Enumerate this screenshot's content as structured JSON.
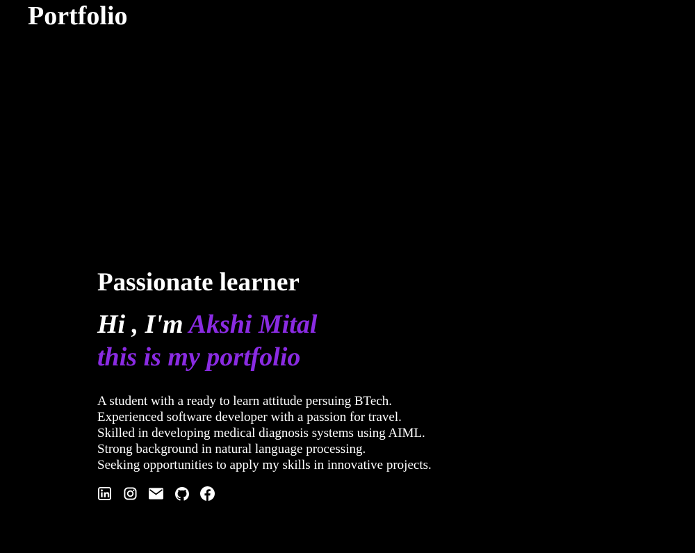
{
  "header": {
    "brand": "Portfolio"
  },
  "hero": {
    "tagline": "Passionate learner",
    "greeting_prefix": "Hi , I'm ",
    "name": "Akshi Mital",
    "greeting_suffix": "this is my portfolio",
    "bio": [
      "A student with a ready to learn attitude persuing BTech.",
      "Experienced software developer with a passion for travel.",
      "Skilled in developing medical diagnosis systems using AIML.",
      "Strong background in natural language processing.",
      "Seeking opportunities to apply my skills in innovative projects."
    ]
  },
  "socials": [
    {
      "icon": "linkedin-icon"
    },
    {
      "icon": "instagram-icon"
    },
    {
      "icon": "envelope-icon"
    },
    {
      "icon": "github-icon"
    },
    {
      "icon": "facebook-icon"
    }
  ],
  "colors": {
    "background": "#000000",
    "text": "#ffffff",
    "accent": "#8a2be2"
  }
}
